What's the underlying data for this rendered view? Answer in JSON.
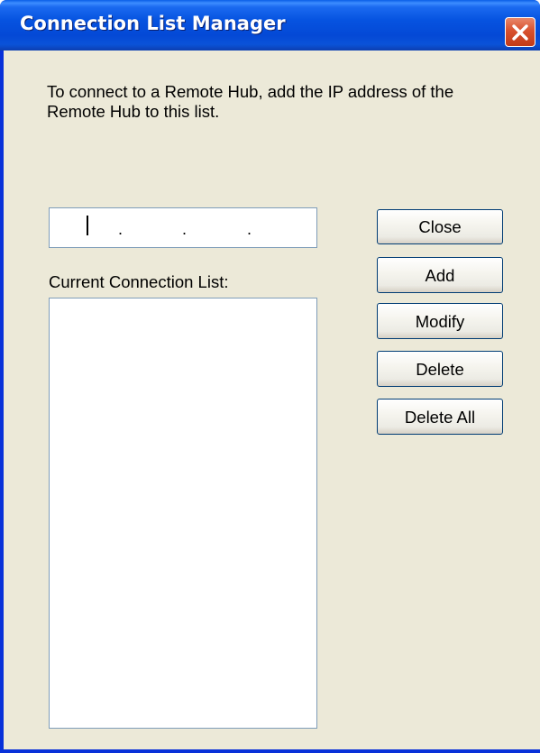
{
  "window": {
    "title": "Connection List Manager"
  },
  "instruction": {
    "text": "To connect to a Remote Hub, add the IP address of the Remote Hub to this list."
  },
  "ip_input": {
    "separators": [
      ".",
      ".",
      "."
    ],
    "value": ""
  },
  "connection_list": {
    "label": "Current Connection List:",
    "items": []
  },
  "buttons": {
    "close": "Close",
    "add": "Add",
    "modify": "Modify",
    "delete": "Delete",
    "delete_all": "Delete All"
  },
  "icons": {
    "title_close": "close-icon"
  },
  "colors": {
    "titlebar": "#0653e0",
    "client_bg": "#ece9d8",
    "close_button": "#d8512e",
    "field_border": "#7f9db9"
  }
}
